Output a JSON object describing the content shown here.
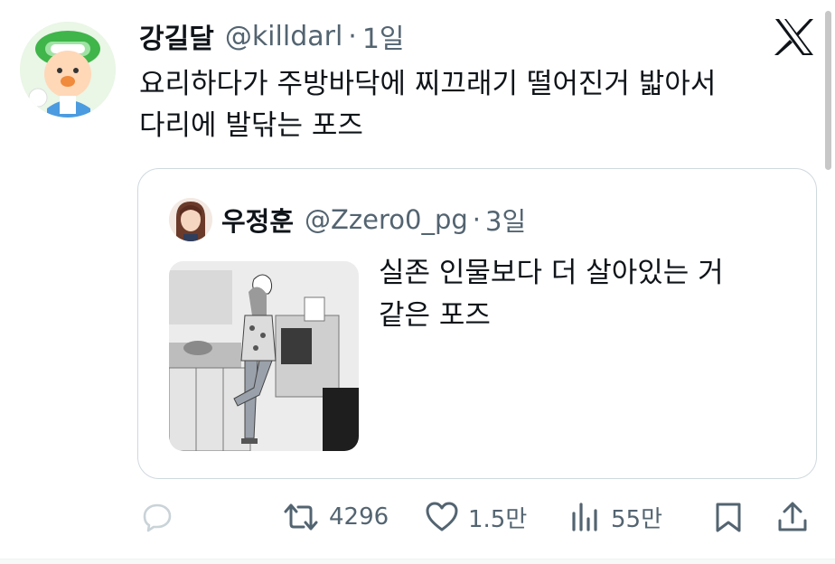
{
  "author": {
    "display_name": "강길달",
    "handle": "@killdarl",
    "separator": "·",
    "age": "1일"
  },
  "tweet": {
    "text_line1": "요리하다가 주방바닥에 찌끄래기 떨어진거 밟아서",
    "text_line2": "다리에 발닦는 포즈"
  },
  "quoted": {
    "display_name": "우정훈",
    "handle": "@Zzero0_pg",
    "separator": "·",
    "age": "3일",
    "text_line1": "실존 인물보다 더 살아있는 거",
    "text_line2": "같은 포즈"
  },
  "actions": {
    "retweets": "4296",
    "likes": "1.5만",
    "views": "55만"
  },
  "icons": {
    "brand": "x-logo-icon",
    "reply": "reply-icon",
    "retweet": "retweet-icon",
    "like": "heart-icon",
    "views": "views-icon",
    "bookmark": "bookmark-icon",
    "share": "share-icon"
  },
  "colors": {
    "text_primary": "#0f1419",
    "text_secondary": "#536471",
    "border": "#cfd9de",
    "reply_icon_faded": "#c9d3d8"
  }
}
